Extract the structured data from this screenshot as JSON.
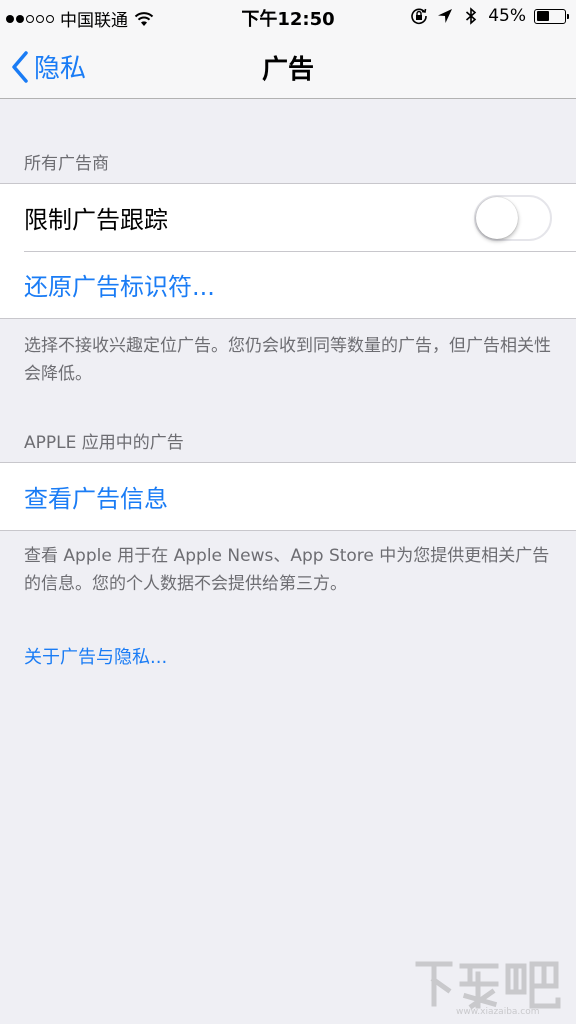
{
  "status_bar": {
    "carrier": "中国联通",
    "signal_bars": 2,
    "signal_total": 5,
    "time": "下午12:50",
    "battery_text": "45%",
    "battery_level": 0.45,
    "icons": [
      "wifi-icon",
      "rotation-lock-icon",
      "location-icon",
      "bluetooth-icon",
      "battery-icon"
    ]
  },
  "nav": {
    "back_label": "隐私",
    "title": "广告"
  },
  "section1": {
    "header": "所有广告商",
    "limit_tracking_label": "限制广告跟踪",
    "limit_tracking_on": false,
    "reset_label": "还原广告标识符...",
    "footer": "选择不接收兴趣定位广告。您仍会收到同等数量的广告，但广告相关性会降低。"
  },
  "section2": {
    "header": "APPLE 应用中的广告",
    "view_info_label": "查看广告信息",
    "footer": "查看 Apple 用于在 Apple News、App Store 中为您提供更相关广告的信息。您的个人数据不会提供给第三方。"
  },
  "about_link": "关于广告与隐私...",
  "watermark_url": "www.xiazaiba.com",
  "colors": {
    "accent": "#1a7cf5",
    "background": "#efeff4",
    "secondary_text": "#6d6d72"
  }
}
